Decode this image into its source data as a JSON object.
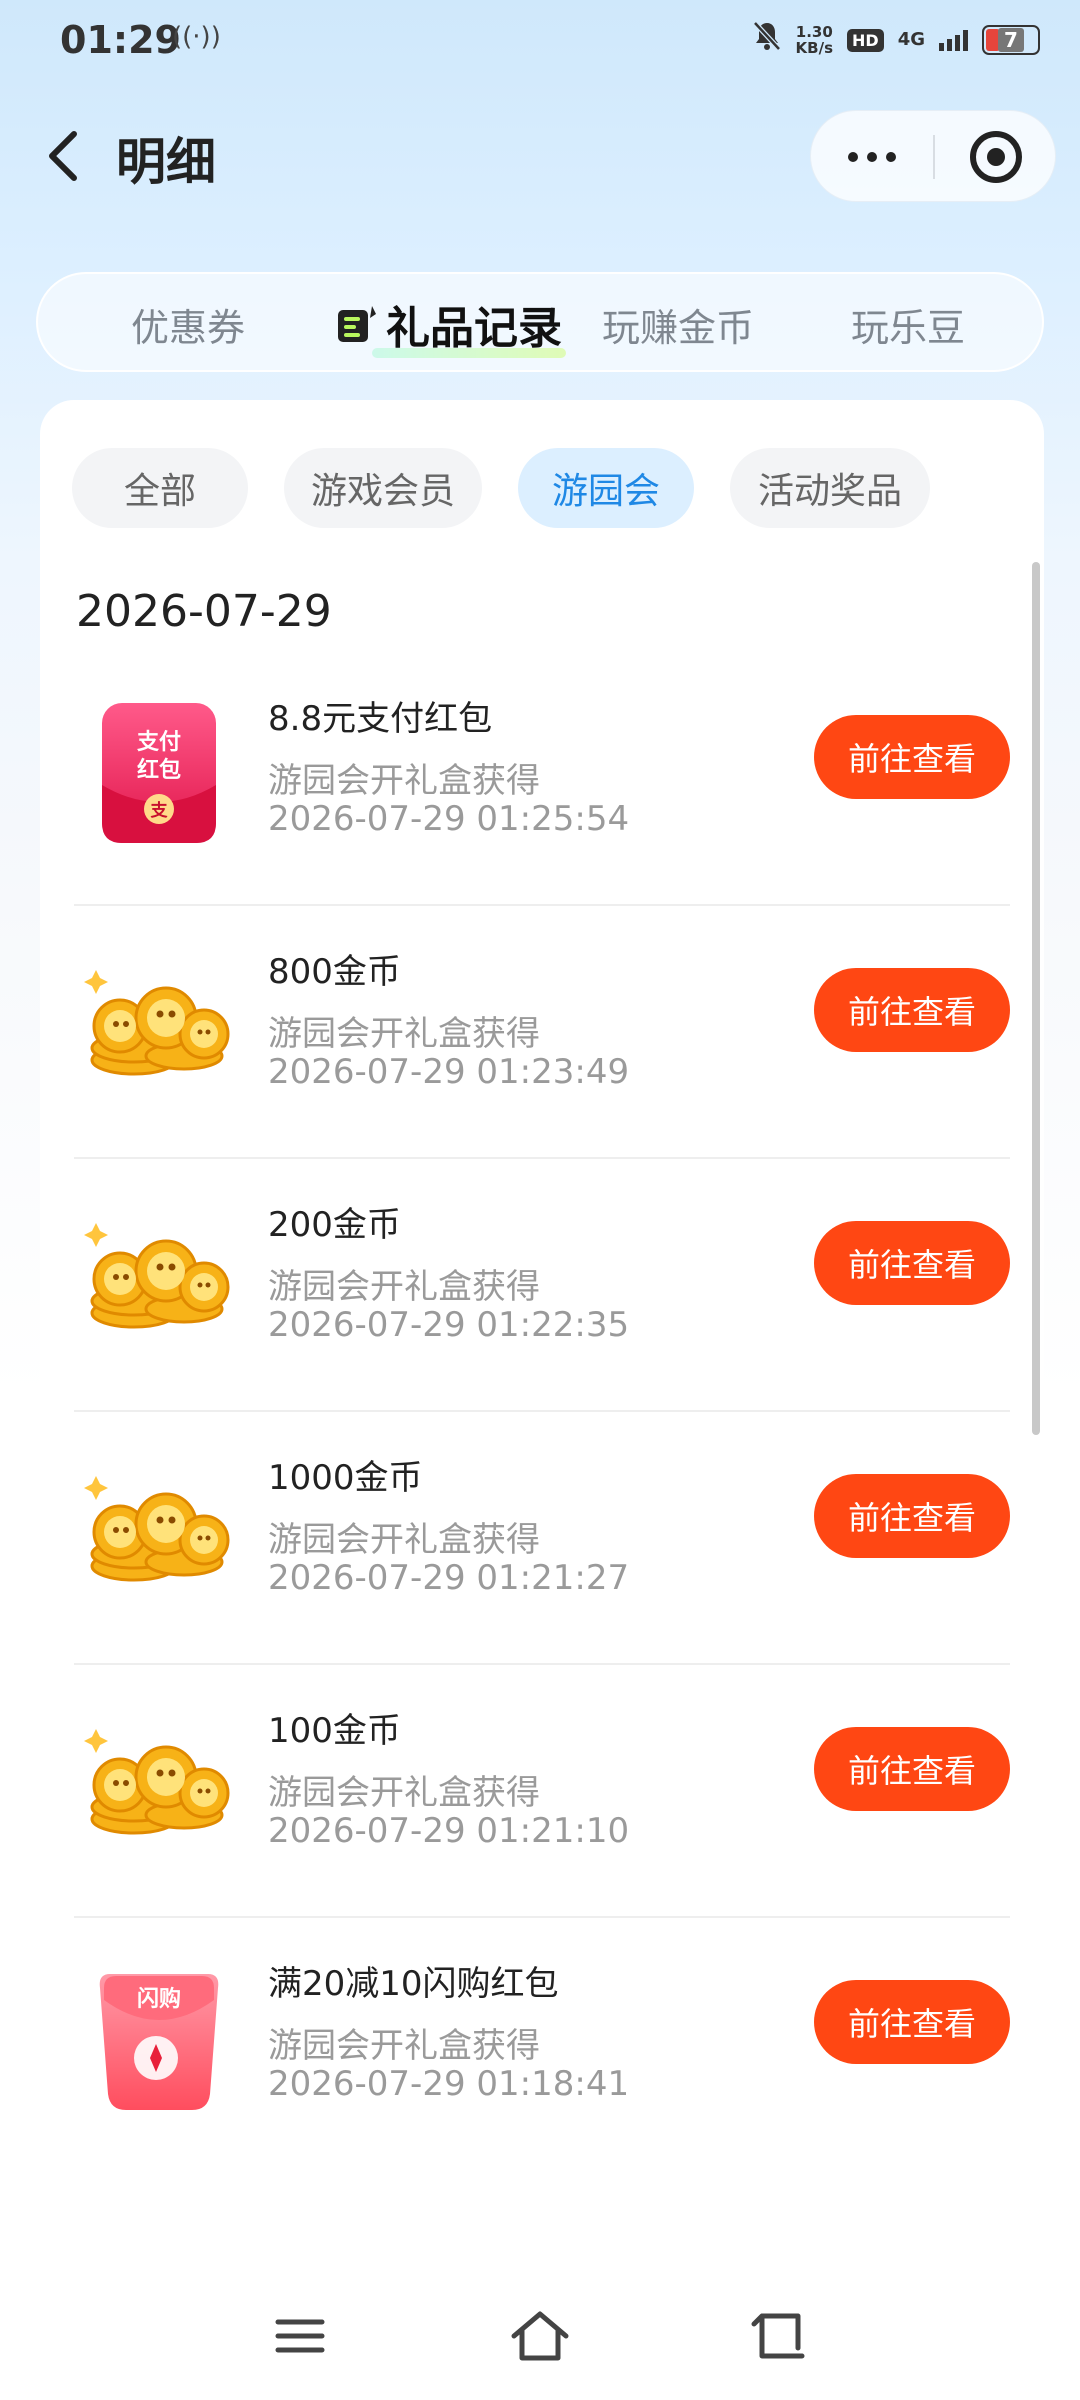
{
  "status_bar": {
    "time": "01:29",
    "speed_value": "1.30",
    "speed_unit": "KB/s",
    "hd": "HD",
    "network": "4G",
    "battery": "7"
  },
  "header": {
    "title": "明细"
  },
  "main_tabs": [
    {
      "label": "优惠券",
      "active": false
    },
    {
      "label": "礼品记录",
      "active": true
    },
    {
      "label": "玩赚金币",
      "active": false
    },
    {
      "label": "玩乐豆",
      "active": false
    }
  ],
  "sub_tabs": [
    {
      "label": "全部",
      "active": false
    },
    {
      "label": "游戏会员",
      "active": false
    },
    {
      "label": "游园会",
      "active": true
    },
    {
      "label": "活动奖品",
      "active": false
    }
  ],
  "date_heading": "2026-07-29",
  "records": [
    {
      "title": "8.8元支付红包",
      "source": "游园会开礼盒获得",
      "time": "2026-07-29 01:25:54",
      "button": "前往查看",
      "icon": "payment-red-packet-icon",
      "icon_text": [
        "支付",
        "红包",
        "支"
      ]
    },
    {
      "title": "800金币",
      "source": "游园会开礼盒获得",
      "time": "2026-07-29 01:23:49",
      "button": "前往查看",
      "icon": "gold-coins-icon"
    },
    {
      "title": "200金币",
      "source": "游园会开礼盒获得",
      "time": "2026-07-29 01:22:35",
      "button": "前往查看",
      "icon": "gold-coins-icon"
    },
    {
      "title": "1000金币",
      "source": "游园会开礼盒获得",
      "time": "2026-07-29 01:21:27",
      "button": "前往查看",
      "icon": "gold-coins-icon"
    },
    {
      "title": "100金币",
      "source": "游园会开礼盒获得",
      "time": "2026-07-29 01:21:10",
      "button": "前往查看",
      "icon": "gold-coins-icon"
    },
    {
      "title": "满20减10闪购红包",
      "source": "游园会开礼盒获得",
      "time": "2026-07-29 01:18:41",
      "button": "前往查看",
      "icon": "flash-sale-red-packet-icon",
      "icon_text": [
        "闪购"
      ]
    }
  ],
  "colors": {
    "accent_button": "#ff4713",
    "active_sub_tab_text": "#1f88e5",
    "active_sub_tab_bg": "#dcefff"
  }
}
